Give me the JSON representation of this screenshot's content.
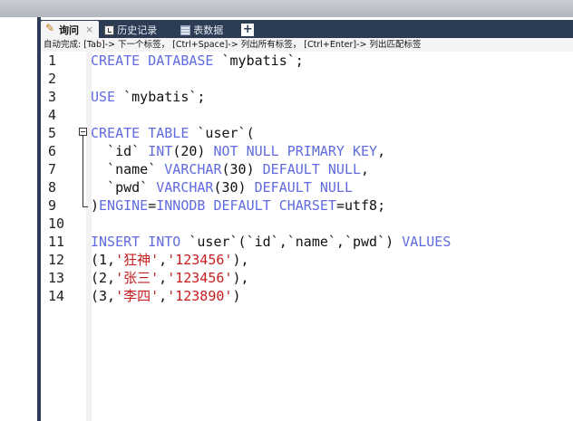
{
  "tabs": [
    {
      "label": "询问",
      "icon": "pencil-icon",
      "active": true
    },
    {
      "label": "历史记录",
      "icon": "history-icon",
      "active": false
    },
    {
      "label": "表数据",
      "icon": "table-icon",
      "active": false
    }
  ],
  "tab_close_glyph": "×",
  "new_tab_glyph": "+",
  "hint_text": "自动完成: [Tab]-> 下一个标签， [Ctrl+Space]-> 列出所有标签， [Ctrl+Enter]-> 列出匹配标签",
  "editor": {
    "line_numbers": [
      "1",
      "2",
      "3",
      "4",
      "5",
      "6",
      "7",
      "8",
      "9",
      "10",
      "11",
      "12",
      "13",
      "14"
    ],
    "lines": [
      [
        {
          "t": "CREATE DATABASE",
          "c": "kw"
        },
        {
          "t": " `mybatis`;",
          "c": "p"
        }
      ],
      [],
      [
        {
          "t": "USE",
          "c": "kw"
        },
        {
          "t": " `mybatis`;",
          "c": "p"
        }
      ],
      [],
      [
        {
          "t": "CREATE TABLE",
          "c": "kw"
        },
        {
          "t": " `user`(",
          "c": "p"
        }
      ],
      [
        {
          "t": "  `id` ",
          "c": "p"
        },
        {
          "t": "INT",
          "c": "kw"
        },
        {
          "t": "(20) ",
          "c": "p"
        },
        {
          "t": "NOT NULL PRIMARY KEY",
          "c": "kw"
        },
        {
          "t": ",",
          "c": "p"
        }
      ],
      [
        {
          "t": "  `name` ",
          "c": "p"
        },
        {
          "t": "VARCHAR",
          "c": "kw"
        },
        {
          "t": "(30) ",
          "c": "p"
        },
        {
          "t": "DEFAULT NULL",
          "c": "kw"
        },
        {
          "t": ",",
          "c": "p"
        }
      ],
      [
        {
          "t": "  `pwd` ",
          "c": "p"
        },
        {
          "t": "VARCHAR",
          "c": "kw"
        },
        {
          "t": "(30) ",
          "c": "p"
        },
        {
          "t": "DEFAULT NULL",
          "c": "kw"
        }
      ],
      [
        {
          "t": ")",
          "c": "p"
        },
        {
          "t": "ENGINE",
          "c": "kw"
        },
        {
          "t": "=",
          "c": "p"
        },
        {
          "t": "INNODB DEFAULT CHARSET",
          "c": "kw"
        },
        {
          "t": "=utf8;",
          "c": "p"
        }
      ],
      [],
      [
        {
          "t": "INSERT INTO",
          "c": "kw"
        },
        {
          "t": " `user`(`id`,`name`,`pwd`) ",
          "c": "p"
        },
        {
          "t": "VALUES",
          "c": "kw"
        }
      ],
      [
        {
          "t": "(1,",
          "c": "p"
        },
        {
          "t": "'狂神'",
          "c": "str"
        },
        {
          "t": ",",
          "c": "p"
        },
        {
          "t": "'123456'",
          "c": "str"
        },
        {
          "t": "),",
          "c": "p"
        }
      ],
      [
        {
          "t": "(2,",
          "c": "p"
        },
        {
          "t": "'张三'",
          "c": "str"
        },
        {
          "t": ",",
          "c": "p"
        },
        {
          "t": "'123456'",
          "c": "str"
        },
        {
          "t": "),",
          "c": "p"
        }
      ],
      [
        {
          "t": "(3,",
          "c": "p"
        },
        {
          "t": "'李四'",
          "c": "str"
        },
        {
          "t": ",",
          "c": "p"
        },
        {
          "t": "'123890'",
          "c": "str"
        },
        {
          "t": ")",
          "c": "p"
        }
      ]
    ]
  },
  "colors": {
    "keyword": "#5f6bdf",
    "string": "#c51e1e",
    "plain": "#111111",
    "tabbar": "#2c3c55"
  }
}
